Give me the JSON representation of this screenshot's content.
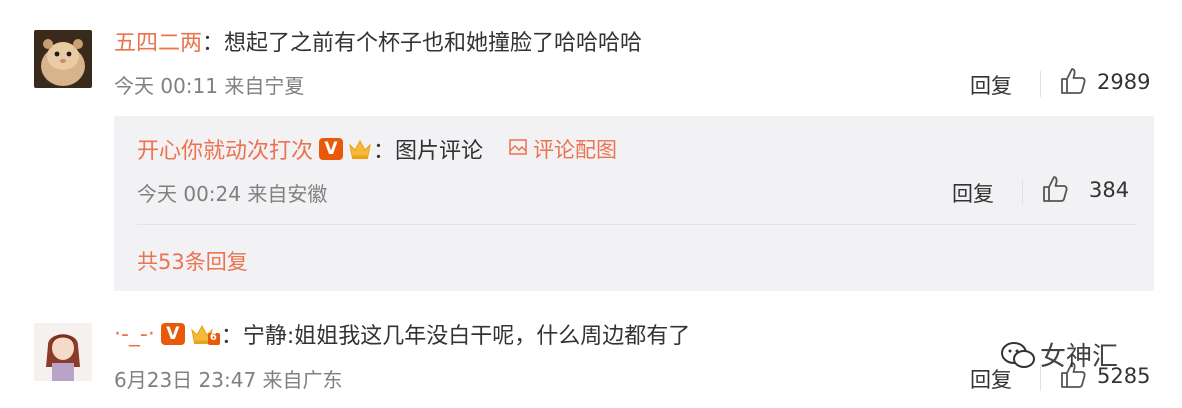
{
  "comments": [
    {
      "username": "五四二两",
      "text": "：想起了之前有个杯子也和她撞脸了哈哈哈哈",
      "time": "今天 00:11",
      "location": "来自宁夏",
      "reply_label": "回复",
      "likes": "2989"
    },
    {
      "username": "·-_-·",
      "text": "：宁静:姐姐我这几年没白干呢，什么周边都有了",
      "time": "6月23日 23:47",
      "location": "来自广东",
      "reply_label": "回复",
      "likes": "5285",
      "crown_level": "6"
    }
  ],
  "sub_reply": {
    "username": "开心你就动次打次",
    "text": "：图片评论",
    "pic_link": "评论配图",
    "time": "今天 00:24",
    "location": "来自安徽",
    "reply_label": "回复",
    "likes": "384",
    "more_replies": "共53条回复"
  },
  "badge": {
    "v_label": "V"
  },
  "watermark": {
    "text": "女神汇"
  },
  "colors": {
    "name": "#eb7350",
    "badge": "#e8590c",
    "reply_bg": "#f2f2f5"
  }
}
